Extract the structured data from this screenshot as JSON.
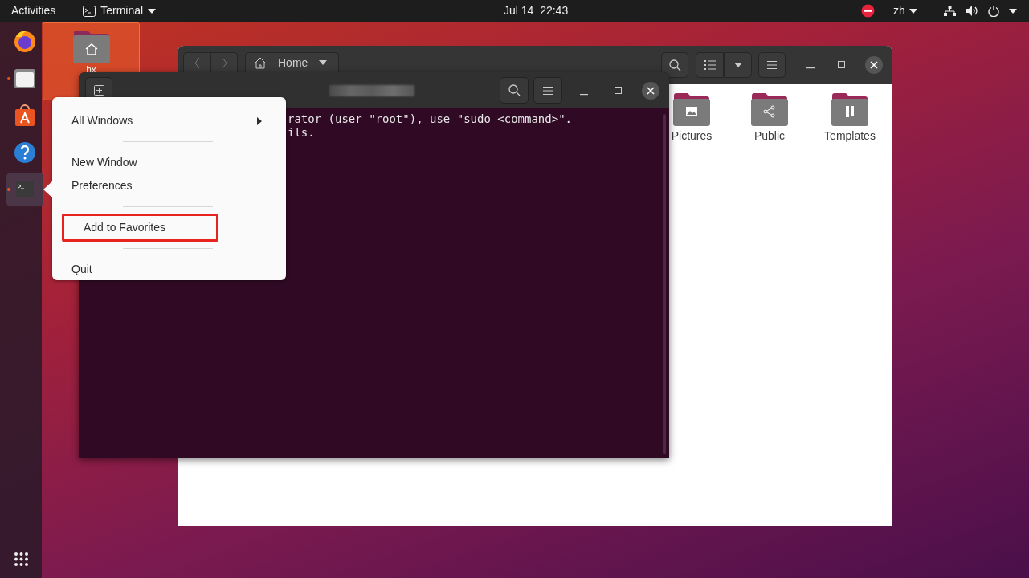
{
  "top_bar": {
    "activities": "Activities",
    "app_menu": "Terminal",
    "clock": "Jul 14  22:43",
    "keyboard": "zh"
  },
  "dock": [
    {
      "kind": "browser",
      "running": false,
      "selected": false
    },
    {
      "kind": "files",
      "running": true,
      "selected": false
    },
    {
      "kind": "software",
      "running": false,
      "selected": false
    },
    {
      "kind": "help",
      "running": false,
      "selected": false
    },
    {
      "kind": "terminal",
      "running": true,
      "selected": true
    }
  ],
  "desktop": {
    "home_label": "hx"
  },
  "files_window": {
    "location": "Home",
    "folders": [
      {
        "name": "Pictures",
        "kind": "pictures"
      },
      {
        "name": "Public",
        "kind": "public"
      },
      {
        "name": "Templates",
        "kind": "templates"
      }
    ]
  },
  "terminal": {
    "lines": [
      "rator (user \"root\"), use \"sudo <command>\".",
      "ils."
    ]
  },
  "context_menu": {
    "items": [
      {
        "kind": "item",
        "label": "All Windows",
        "submenu": true,
        "highlighted": false
      },
      {
        "kind": "separator"
      },
      {
        "kind": "item",
        "label": "New Window",
        "submenu": false,
        "highlighted": false
      },
      {
        "kind": "item",
        "label": "Preferences",
        "submenu": false,
        "highlighted": false
      },
      {
        "kind": "separator"
      },
      {
        "kind": "item",
        "label": "Add to Favorites",
        "submenu": false,
        "highlighted": true
      },
      {
        "kind": "separator"
      },
      {
        "kind": "item",
        "label": "Quit",
        "submenu": false,
        "highlighted": false
      }
    ]
  }
}
